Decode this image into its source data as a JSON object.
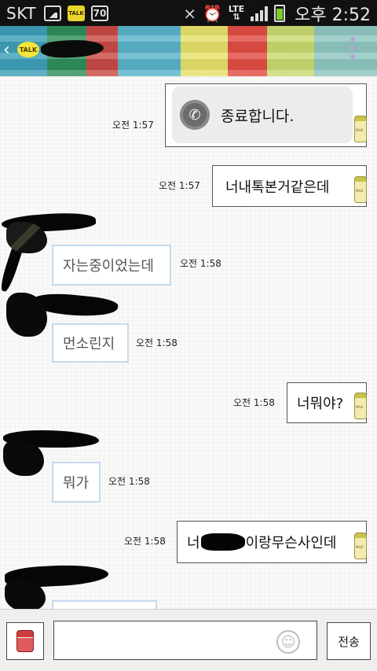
{
  "status_bar": {
    "carrier": "SKT",
    "network": "LTE",
    "time": "오후 2:52",
    "icons": [
      "gallery-icon",
      "kakaotalk-icon",
      "app-70-icon",
      "mute-icon",
      "alarm-icon",
      "signal-icon",
      "battery-icon"
    ],
    "app70_label": "70",
    "talk_label": "TALK",
    "battery_color": "#7ccf2a"
  },
  "header": {
    "logo_text": "TALK"
  },
  "messages": [
    {
      "side": "out",
      "kind": "call",
      "text": "종료합니다.",
      "time": "오전 1:57"
    },
    {
      "side": "out",
      "text": "너내톡본거같은데",
      "time": "오전 1:57"
    },
    {
      "side": "in",
      "text": "자는중이었는데",
      "time": "오전 1:58"
    },
    {
      "side": "in",
      "text": "먼소린지",
      "time": "오전 1:58"
    },
    {
      "side": "out",
      "text": "너뭐야?",
      "time": "오전 1:58"
    },
    {
      "side": "in",
      "text": "뭐가",
      "time": "오전 1:58"
    },
    {
      "side": "out",
      "text_before": "너",
      "text_after": "이랑무슨사인데",
      "time": "오전 1:58"
    }
  ],
  "input_bar": {
    "placeholder": "",
    "send_label": "전송"
  },
  "colors": {
    "incoming_border": "#c2daf0",
    "outgoing_border": "#555555",
    "status_bar_bg": "#111111"
  }
}
